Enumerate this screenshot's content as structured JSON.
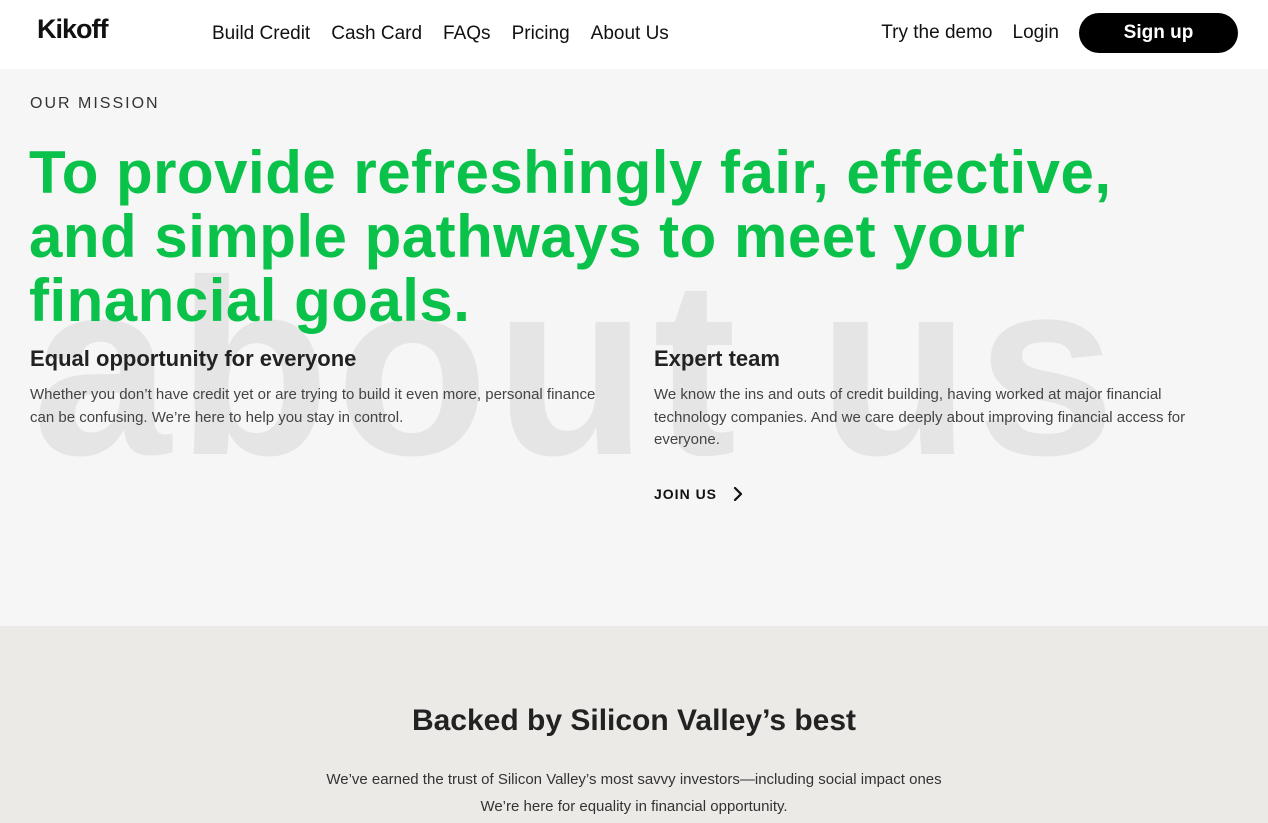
{
  "header": {
    "logo": "Kikoff",
    "nav": [
      "Build Credit",
      "Cash Card",
      "FAQs",
      "Pricing",
      "About Us"
    ],
    "demo_label": "Try the demo",
    "login_label": "Login",
    "signup_label": "Sign up"
  },
  "hero": {
    "eyebrow": "OUR MISSION",
    "headline": "To provide refreshingly fair, effective, and simple pathways to meet your financial goals.",
    "watermark": "about us",
    "features": [
      {
        "title": "Equal opportunity for everyone",
        "text": "Whether you don’t have credit yet or are trying to build it even more, personal finance can be confusing. We’re here to help you stay in control."
      },
      {
        "title": "Expert team",
        "text": "We know the ins and outs of credit building, having worked at major financial technology companies. And we care deeply about improving financial access for everyone."
      }
    ],
    "join_label": "JOIN US"
  },
  "backed": {
    "title": "Backed by Silicon Valley’s best",
    "line1": "We’ve earned the trust of Silicon Valley’s most savvy investors—including social impact ones",
    "line2": "We’re here for equality in financial opportunity."
  },
  "colors": {
    "accent": "#0ac24a",
    "hero_bg": "#f6f6f6",
    "backed_bg": "#eceae7",
    "button_bg": "#000000"
  }
}
